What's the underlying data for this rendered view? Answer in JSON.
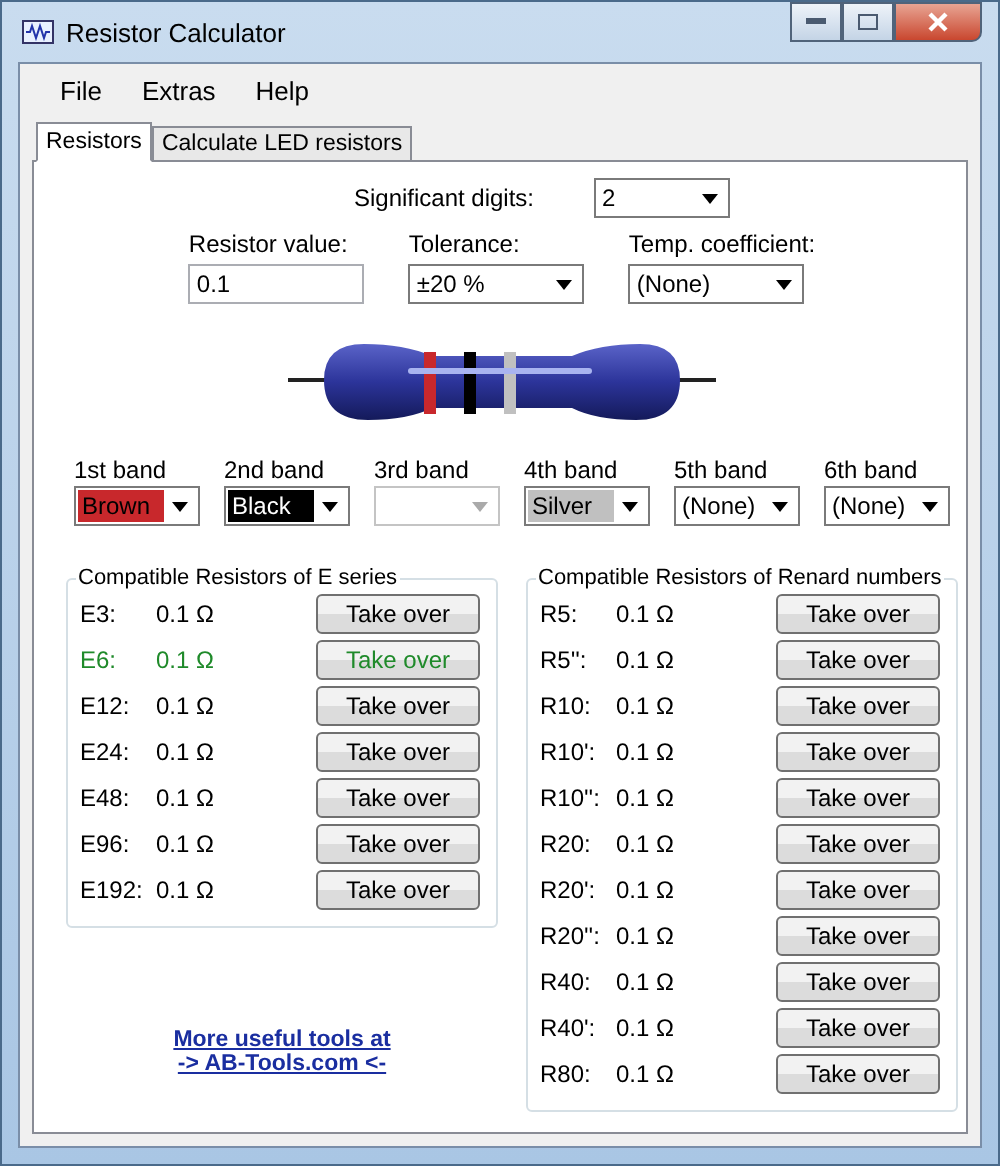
{
  "window": {
    "title": "Resistor Calculator"
  },
  "menu": [
    "File",
    "Extras",
    "Help"
  ],
  "tabs": [
    {
      "label": "Resistors",
      "selected": true
    },
    {
      "label": "Calculate LED resistors",
      "selected": false
    }
  ],
  "significant_digits": {
    "label": "Significant digits:",
    "value": "2"
  },
  "resistor_value": {
    "label": "Resistor value:",
    "value": "0.1"
  },
  "tolerance": {
    "label": "Tolerance:",
    "value": "±20 %"
  },
  "temp_coefficient": {
    "label": "Temp. coefficient:",
    "value": "(None)"
  },
  "bands": [
    {
      "label": "1st band",
      "value": "Brown",
      "color": "#c8282c",
      "disabled": false
    },
    {
      "label": "2nd band",
      "value": "Black",
      "color": "#000000",
      "disabled": false
    },
    {
      "label": "3rd band",
      "disabled": true
    },
    {
      "label": "4th band",
      "value": "Silver",
      "color": "#c0c0c0",
      "disabled": false
    },
    {
      "label": "5th band",
      "value": "(None)",
      "disabled": false
    },
    {
      "label": "6th band",
      "value": "(None)",
      "disabled": false
    }
  ],
  "e_series": {
    "title": "Compatible Resistors of E series",
    "rows": [
      {
        "name": "E3:",
        "value": "0.1 Ω",
        "button": "Take over",
        "highlighted": false
      },
      {
        "name": "E6:",
        "value": "0.1 Ω",
        "button": "Take over",
        "highlighted": true
      },
      {
        "name": "E12:",
        "value": "0.1 Ω",
        "button": "Take over",
        "highlighted": false
      },
      {
        "name": "E24:",
        "value": "0.1 Ω",
        "button": "Take over",
        "highlighted": false
      },
      {
        "name": "E48:",
        "value": "0.1 Ω",
        "button": "Take over",
        "highlighted": false
      },
      {
        "name": "E96:",
        "value": "0.1 Ω",
        "button": "Take over",
        "highlighted": false
      },
      {
        "name": "E192:",
        "value": "0.1 Ω",
        "button": "Take over",
        "highlighted": false
      }
    ]
  },
  "renard": {
    "title": "Compatible Resistors of Renard numbers",
    "rows": [
      {
        "name": "R5:",
        "value": "0.1 Ω",
        "button": "Take over"
      },
      {
        "name": "R5'':",
        "value": "0.1 Ω",
        "button": "Take over"
      },
      {
        "name": "R10:",
        "value": "0.1 Ω",
        "button": "Take over"
      },
      {
        "name": "R10':",
        "value": "0.1 Ω",
        "button": "Take over"
      },
      {
        "name": "R10'':",
        "value": "0.1 Ω",
        "button": "Take over"
      },
      {
        "name": "R20:",
        "value": "0.1 Ω",
        "button": "Take over"
      },
      {
        "name": "R20':",
        "value": "0.1 Ω",
        "button": "Take over"
      },
      {
        "name": "R20'':",
        "value": "0.1 Ω",
        "button": "Take over"
      },
      {
        "name": "R40:",
        "value": "0.1 Ω",
        "button": "Take over"
      },
      {
        "name": "R40':",
        "value": "0.1 Ω",
        "button": "Take over"
      },
      {
        "name": "R80:",
        "value": "0.1 Ω",
        "button": "Take over"
      }
    ]
  },
  "link": [
    "More useful tools at",
    "-> AB-Tools.com <-"
  ]
}
